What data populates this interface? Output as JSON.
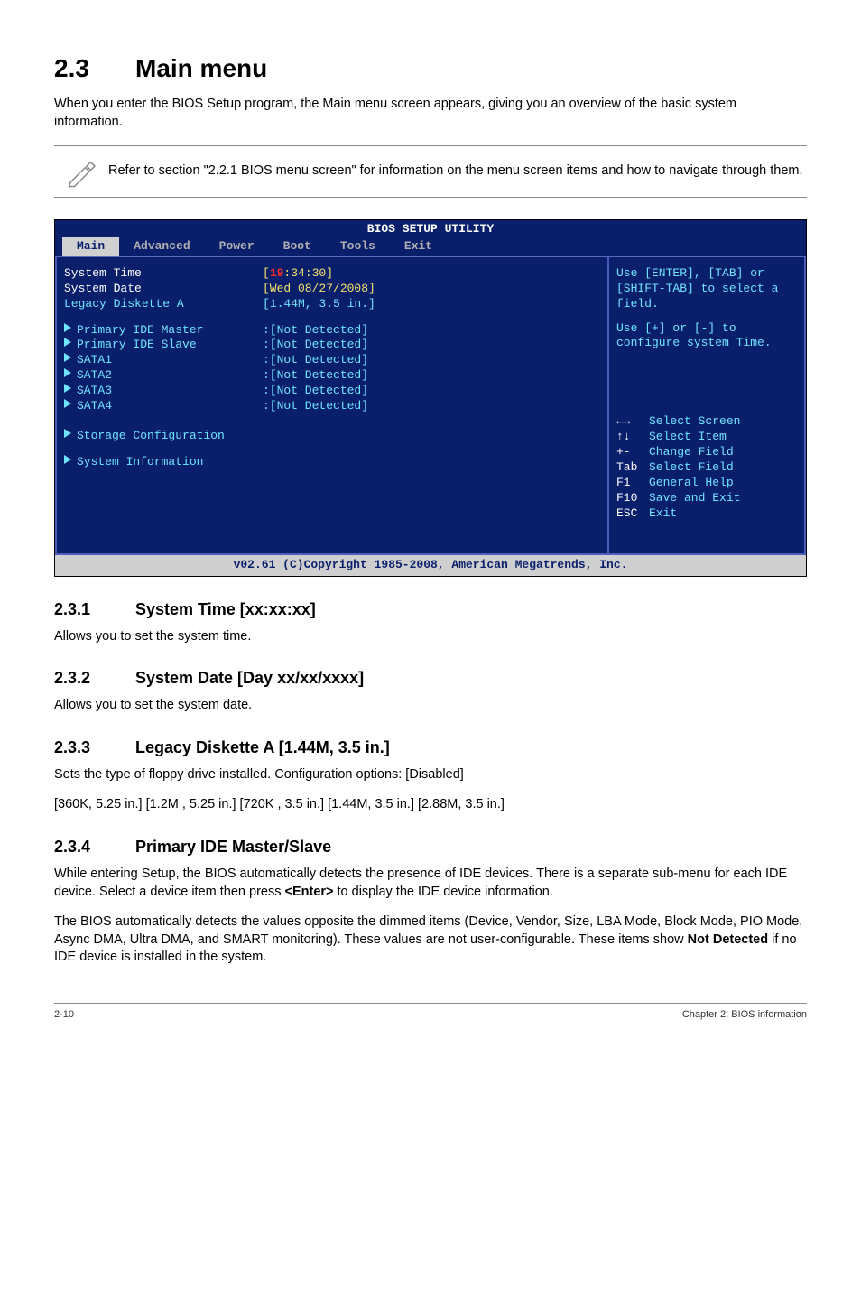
{
  "section": {
    "number": "2.3",
    "title": "Main menu"
  },
  "intro": "When you enter the BIOS Setup program, the Main menu screen appears, giving you an overview of the basic system information.",
  "note": "Refer to section \"2.2.1 BIOS menu screen\" for information on the menu screen items and how to navigate through them.",
  "bios": {
    "title": "BIOS SETUP UTILITY",
    "tabs": [
      "Main",
      "Advanced",
      "Power",
      "Boot",
      "Tools",
      "Exit"
    ],
    "active_tab": "Main",
    "left": {
      "system_time_label": "System Time",
      "system_time_value": "[19:34:30]",
      "system_date_label": "System Date",
      "system_date_value": "[Wed 08/27/2008]",
      "legacy_label": "Legacy Diskette A",
      "legacy_value": "[1.44M, 3.5 in.]",
      "items": [
        {
          "label": "Primary IDE Master",
          "value": ":[Not Detected]"
        },
        {
          "label": "Primary IDE Slave",
          "value": ":[Not Detected]"
        },
        {
          "label": "SATA1",
          "value": ":[Not Detected]"
        },
        {
          "label": "SATA2",
          "value": ":[Not Detected]"
        },
        {
          "label": "SATA3",
          "value": ":[Not Detected]"
        },
        {
          "label": "SATA4",
          "value": ":[Not Detected]"
        }
      ],
      "storage": "Storage Configuration",
      "sysinfo": "System Information"
    },
    "right": {
      "help1": "Use [ENTER], [TAB] or [SHIFT-TAB] to select a field.",
      "help2": "Use [+] or [-] to configure system Time.",
      "keys": [
        {
          "sym": "←→",
          "desc": "Select Screen"
        },
        {
          "sym": "↑↓",
          "desc": "Select Item"
        },
        {
          "sym": "+-",
          "desc": "Change Field"
        },
        {
          "sym": "Tab",
          "desc": "Select Field"
        },
        {
          "sym": "F1",
          "desc": "General Help"
        },
        {
          "sym": "F10",
          "desc": "Save and Exit"
        },
        {
          "sym": "ESC",
          "desc": "Exit"
        }
      ]
    },
    "footer": "v02.61 (C)Copyright 1985-2008, American Megatrends, Inc."
  },
  "s231": {
    "num": "2.3.1",
    "title": "System Time [xx:xx:xx]",
    "body": "Allows you to set the system time."
  },
  "s232": {
    "num": "2.3.2",
    "title": "System Date [Day xx/xx/xxxx]",
    "body": "Allows you to set the system date."
  },
  "s233": {
    "num": "2.3.3",
    "title": "Legacy Diskette A [1.44M, 3.5 in.]",
    "body1": "Sets the type of floppy drive installed. Configuration options: [Disabled]",
    "body2": "[360K, 5.25 in.] [1.2M , 5.25 in.] [720K , 3.5 in.] [1.44M, 3.5 in.] [2.88M, 3.5 in.]"
  },
  "s234": {
    "num": "2.3.4",
    "title": "Primary IDE Master/Slave",
    "p1a": "While entering Setup, the BIOS automatically detects the presence of IDE devices. There is a separate sub-menu for each IDE device. Select a device item then press ",
    "p1b": "<Enter>",
    "p1c": " to display the IDE device information.",
    "p2a": "The BIOS automatically detects the values opposite the dimmed items (Device, Vendor, Size, LBA Mode, Block Mode, PIO Mode, Async DMA, Ultra DMA, and SMART monitoring). These values are not user-configurable. These items show ",
    "p2b": "Not Detected",
    "p2c": " if no IDE device is installed in the system."
  },
  "footer": {
    "left": "2-10",
    "right": "Chapter 2: BIOS information"
  }
}
